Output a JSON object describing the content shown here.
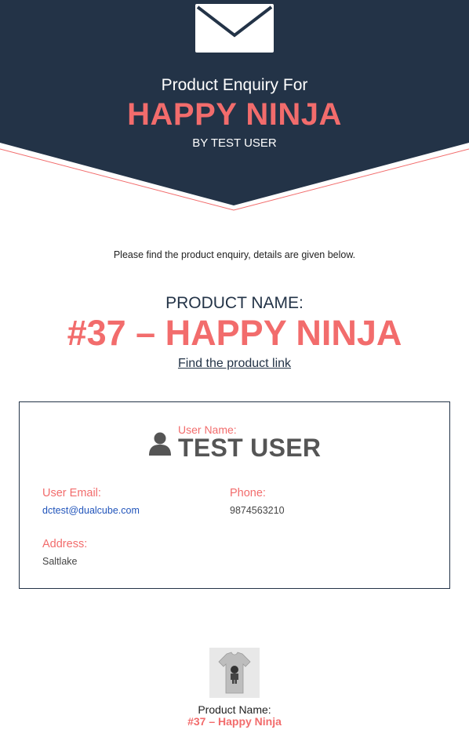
{
  "colors": {
    "navy": "#233347",
    "accent": "#f26c6c"
  },
  "header": {
    "icon": "envelope-icon",
    "subtitle": "Product Enquiry For",
    "title": "HAPPY NINJA",
    "by_line": "BY TEST USER"
  },
  "intro": "Please find the product enquiry, details are given below.",
  "product": {
    "label": "PRODUCT NAME:",
    "name": "#37 – HAPPY NINJA",
    "link_text": "Find the product link"
  },
  "user": {
    "icon": "user-icon",
    "name_label": "User Name:",
    "name": "TEST USER",
    "email_label": "User Email:",
    "email": "dctest@dualcube.com",
    "phone_label": "Phone:",
    "phone": "9874563210",
    "address_label": "Address:",
    "address": "Saltlake"
  },
  "footer": {
    "image": "tshirt-thumbnail",
    "label": "Product Name:",
    "value": "#37 – Happy Ninja"
  }
}
